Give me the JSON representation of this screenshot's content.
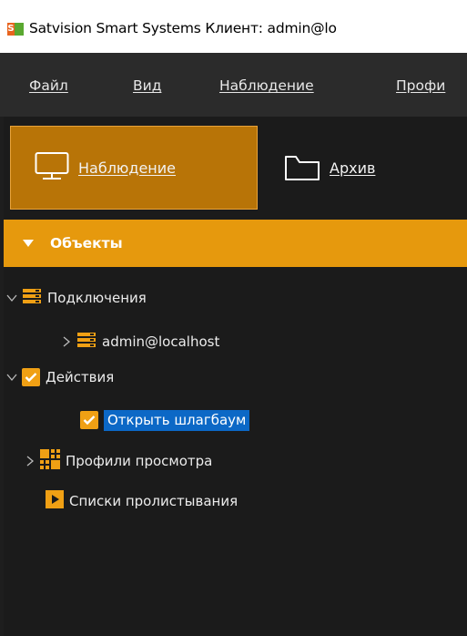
{
  "window": {
    "title": "Satvision Smart Systems Клиент: admin@lo",
    "icon": "satvision-app-icon",
    "icon_letter": "S"
  },
  "menu": [
    {
      "label": "Файл"
    },
    {
      "label": "Вид"
    },
    {
      "label": "Наблюдение"
    },
    {
      "label": "Профи"
    }
  ],
  "modes": {
    "monitoring": {
      "label": "Наблюдение",
      "icon": "monitor-icon",
      "active": true
    },
    "archive": {
      "label": "Архив",
      "icon": "folder-icon",
      "active": false
    }
  },
  "objects_panel": {
    "header": "Объекты",
    "tree": [
      {
        "label": "Подключения",
        "icon": "server-icon",
        "expanded": true
      },
      {
        "label": "admin@localhost",
        "icon": "server-icon",
        "expanded": false
      },
      {
        "label": "Действия",
        "icon": "checkbox-icon",
        "expanded": true
      },
      {
        "label": "Открыть шлагбаум",
        "icon": "checkbox-icon",
        "selected": true
      },
      {
        "label": "Профили просмотра",
        "icon": "grid-icon",
        "expanded": false
      },
      {
        "label": "Списки пролистывания",
        "icon": "play-icon"
      }
    ]
  },
  "colors": {
    "accent": "#e6990d",
    "active_mode": "#b87407",
    "selection": "#0c68c6",
    "menubar": "#2b2b2b",
    "background": "#1b1b1b"
  }
}
